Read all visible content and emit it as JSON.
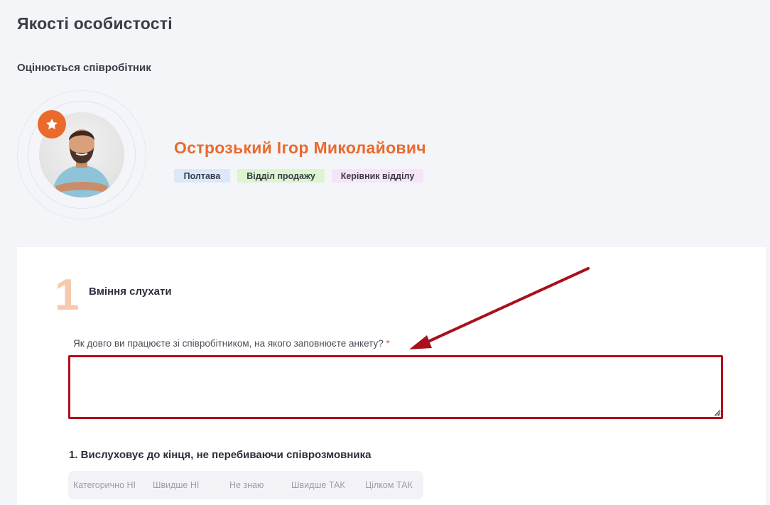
{
  "page": {
    "title": "Якості особистості"
  },
  "evaluated": {
    "label": "Оцінюється співробітник",
    "name": "Острозький Ігор Миколайович",
    "tags": {
      "city": "Полтава",
      "department": "Відділ продажу",
      "role": "Керівник відділу"
    }
  },
  "block": {
    "number": "1",
    "title": "Вміння слухати",
    "question": {
      "label": "Як довго ви працюєте зі співробітником, на якого заповнюєте анкету?",
      "required_mark": "*",
      "value": ""
    },
    "criterion": {
      "title": "1. Вислуховує до кінця, не перебиваючи співрозмовника",
      "options": [
        "Категорично НІ",
        "Швидше НІ",
        "Не знаю",
        "Швидше ТАК",
        "Цілком ТАК"
      ]
    }
  },
  "colors": {
    "accent": "#ea6a2c",
    "highlight": "#b1101b"
  },
  "icons": {
    "badge": "star-icon"
  }
}
